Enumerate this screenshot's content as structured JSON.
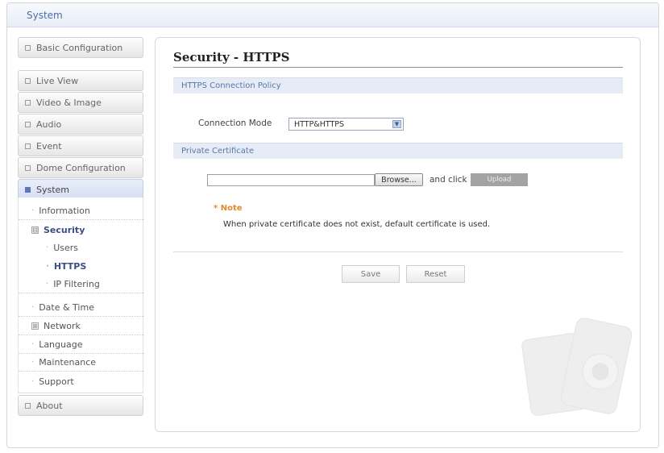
{
  "header": {
    "title": "System"
  },
  "sidebar": {
    "basic_configuration": "Basic Configuration",
    "live_view": "Live View",
    "video_image": "Video & Image",
    "audio": "Audio",
    "event": "Event",
    "dome_configuration": "Dome Configuration",
    "system": "System",
    "system_items": {
      "information": "Information",
      "security": "Security",
      "users": "Users",
      "https": "HTTPS",
      "ip_filtering": "IP Filtering",
      "date_time": "Date & Time",
      "network": "Network",
      "language": "Language",
      "maintenance": "Maintenance",
      "support": "Support"
    },
    "about": "About",
    "expanded_marker": "⊟",
    "collapsed_marker": "⊞"
  },
  "main": {
    "title": "Security - HTTPS",
    "policy_section": "HTTPS Connection Policy",
    "connection_mode_label": "Connection Mode",
    "connection_mode_value": "HTTP&HTTPS",
    "private_cert_section": "Private Certificate",
    "browse_label": "Browse...",
    "and_click": "and click",
    "upload_label": "Upload",
    "note_title": "* Note",
    "note_text": "When private certificate does not exist, default certificate is used.",
    "save_label": "Save",
    "reset_label": "Reset"
  },
  "colors": {
    "accent": "#4a6fa5",
    "section_bg": "#e6ebf5",
    "note": "#e08a2a",
    "active_nav": "#d5def2"
  },
  "icons": {
    "nav_bullet": "square-bullet-icon",
    "dropdown": "chevron-down-icon",
    "watermark": "camera-watermark-icon"
  }
}
